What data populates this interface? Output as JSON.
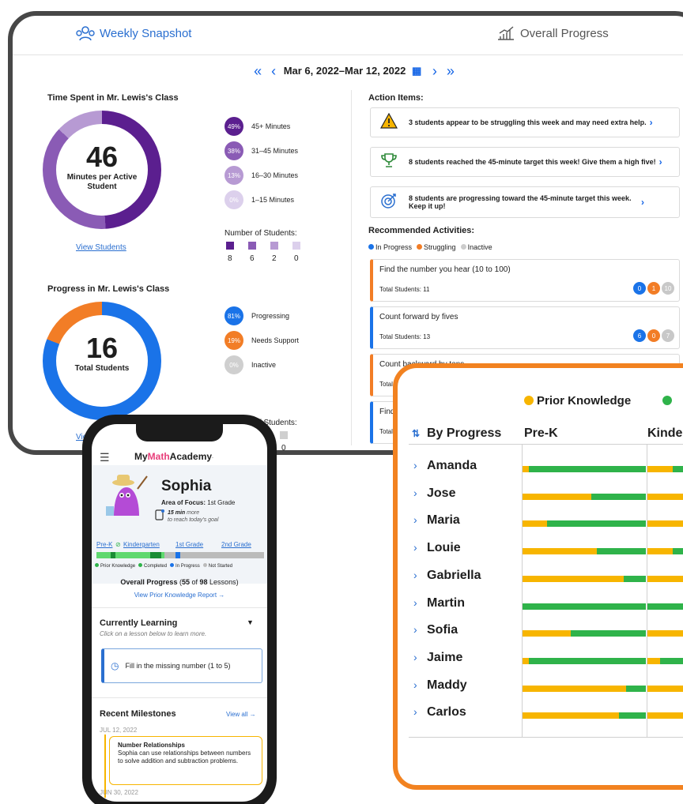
{
  "dashboard": {
    "tabs": {
      "weekly": "Weekly Snapshot",
      "overall": "Overall Progress"
    },
    "date_range": "Mar 6, 2022–Mar 12, 2022",
    "time": {
      "title": "Time Spent in Mr. Lewis's Class",
      "value": "46",
      "label": "Minutes per Active Student",
      "legend": [
        {
          "pct": "49%",
          "label": "45+ Minutes",
          "color": "#5b1f8f"
        },
        {
          "pct": "38%",
          "label": "31–45 Minutes",
          "color": "#8a5bb5"
        },
        {
          "pct": "13%",
          "label": "16–30 Minutes",
          "color": "#b79ad3"
        },
        {
          "pct": "0%",
          "label": "1–15 Minutes",
          "color": "#dcd0ec"
        }
      ],
      "students_title": "Number of Students:",
      "students": [
        "8",
        "6",
        "2",
        "0"
      ],
      "link": "View Students"
    },
    "progress": {
      "title": "Progress in Mr. Lewis's Class",
      "value": "16",
      "label": "Total Students",
      "legend": [
        {
          "pct": "81%",
          "label": "Progressing",
          "color": "#1a73e8"
        },
        {
          "pct": "19%",
          "label": "Needs Support",
          "color": "#f27d26"
        },
        {
          "pct": "0%",
          "label": "Inactive",
          "color": "#cfcfcf"
        }
      ],
      "students_title": "Number of Students:",
      "link": "View",
      "partial_num": "0"
    },
    "action_items": {
      "title": "Action Items:",
      "items": [
        "3 students appear to be struggling this week and may need extra help.",
        "8 students reached the 45-minute target this week! Give them a high five!",
        "8 students are progressing toward the 45-minute target this week. Keep it up!"
      ]
    },
    "recommended": {
      "title": "Recommended Activities:",
      "legend": [
        "In Progress",
        "Struggling",
        "Inactive"
      ],
      "legend_colors": [
        "#1a73e8",
        "#f27d26",
        "#cccccc"
      ],
      "activities": [
        {
          "name": "Find the number you hear (10 to 100)",
          "total": "Total Students: 11",
          "counts": [
            "0",
            "1",
            "10"
          ],
          "border": "#f27d26"
        },
        {
          "name": "Count forward by fives",
          "total": "Total Students: 13",
          "counts": [
            "6",
            "0",
            "7"
          ],
          "border": "#1a73e8"
        },
        {
          "name": "Count backward by tens",
          "total": "Total St",
          "counts": [],
          "border": "#f27d26"
        },
        {
          "name": "Find n",
          "total": "Total S",
          "counts": [],
          "border": "#1a73e8"
        }
      ]
    }
  },
  "progress_card": {
    "legend": [
      "Prior Knowledge"
    ],
    "legend_colors": {
      "prior": "#f7b500",
      "completed": "#2fb34a"
    },
    "header": {
      "by_progress": "By Progress",
      "col1": "Pre-K",
      "col2": "Kinde"
    },
    "students": [
      {
        "name": "Amanda",
        "prek": 0.05,
        "kinder": 0.2
      },
      {
        "name": "Jose",
        "prek": 0.56,
        "kinder": 0.45
      },
      {
        "name": "Maria",
        "prek": 0.2,
        "kinder": 0.35
      },
      {
        "name": "Louie",
        "prek": 0.6,
        "kinder": 0.2
      },
      {
        "name": "Gabriella",
        "prek": 0.82,
        "kinder": 0.8
      },
      {
        "name": "Martin",
        "prek": 0.0,
        "kinder": 0.0
      },
      {
        "name": "Sofia",
        "prek": 0.39,
        "kinder": 0.5
      },
      {
        "name": "Jaime",
        "prek": 0.05,
        "kinder": 0.1
      },
      {
        "name": "Maddy",
        "prek": 0.84,
        "kinder": 0.9
      },
      {
        "name": "Carlos",
        "prek": 0.78,
        "kinder": 0.8
      }
    ]
  },
  "phone": {
    "brand_my": "My",
    "brand_math": "Math",
    "brand_academy": "Academy",
    "brand_tm": "·",
    "student": "Sophia",
    "focus_label": "Area of Focus:",
    "focus_value": "1st Grade",
    "goal_minutes": "15 min",
    "goal_more": "more",
    "goal_text": "to reach today's goal",
    "levels": [
      "Pre-K",
      "Kindergarten",
      "1st Grade",
      "2nd Grade"
    ],
    "legend": [
      "Prior Knowledge",
      "Completed",
      "In Progress",
      "Not Started"
    ],
    "legend_colors": [
      "#2fb34a",
      "#2fb34a",
      "#1a73e8",
      "#bbbbbb"
    ],
    "overall_label": "Overall Progress",
    "overall_done": "55",
    "overall_of": "of",
    "overall_total": "98",
    "overall_unit": "Lessons",
    "report_link": "View Prior Knowledge Report →",
    "currently_learning": "Currently Learning",
    "currently_sub": "Click on a lesson below to learn more.",
    "lesson": "Fill in the missing number (1 to 5)",
    "milestones_title": "Recent Milestones",
    "view_all": "View all →",
    "date1": "JUL 12, 2022",
    "milestone_title": "Number Relationships",
    "milestone_text": "Sophia can use relationships between numbers to solve addition and subtraction problems.",
    "date2": "JUN 30, 2022"
  }
}
